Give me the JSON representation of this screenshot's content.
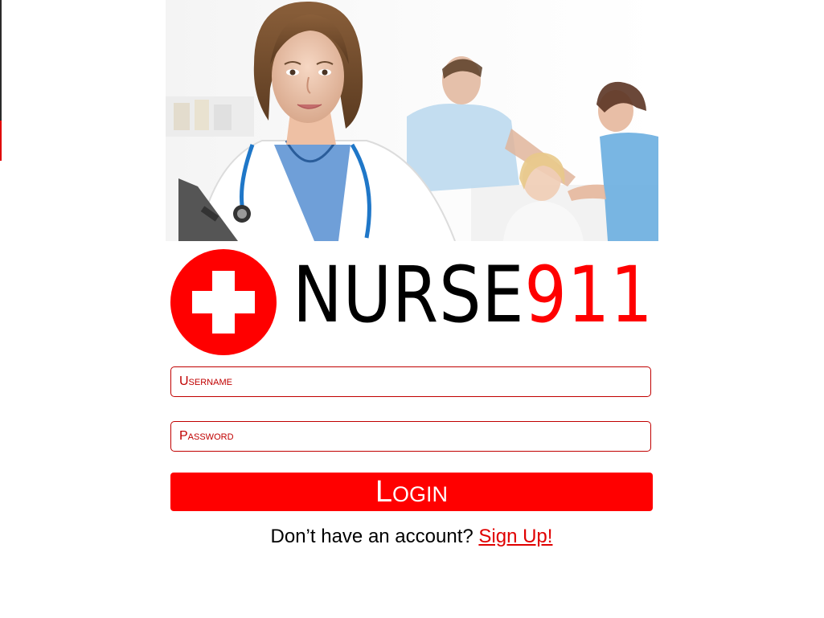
{
  "brand": {
    "name_part_1": "NURSE",
    "name_part_2": "911",
    "accent_color": "#ff0000"
  },
  "hero": {
    "description_icon": "medical-staff-photo"
  },
  "form": {
    "username_placeholder": "Username",
    "password_placeholder": "Password",
    "login_label": "Login"
  },
  "signup": {
    "prompt": "Don’t have an account?",
    "link_label": "Sign Up!"
  }
}
